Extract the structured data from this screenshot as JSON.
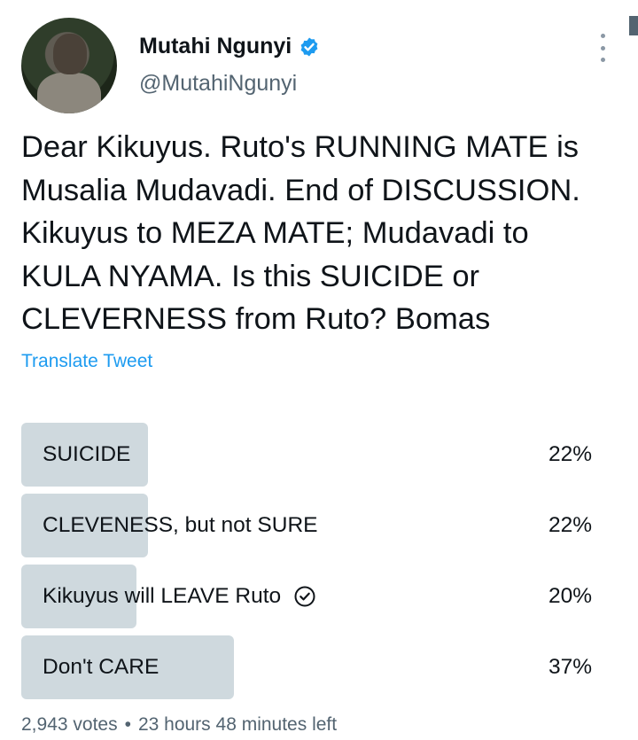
{
  "author": {
    "display_name": "Mutahi Ngunyi",
    "handle": "@MutahiNgunyi",
    "verified": true,
    "avatar_icon": "profile-photo",
    "verified_icon": "verified-badge-icon",
    "menu_icon": "more-options-icon"
  },
  "tweet": {
    "text": "Dear Kikuyus. Ruto's RUNNING MATE is\nMusalia Mudavadi. End of DISCUSSION.\nKikuyus to MEZA MATE; Mudavadi to\nKULA NYAMA. Is this SUICIDE or\nCLEVERNESS from Ruto? Bomas",
    "translate_label": "Translate Tweet"
  },
  "poll": {
    "options": [
      {
        "label": "SUICIDE",
        "percent_label": "22%",
        "percent": 22,
        "voted": false
      },
      {
        "label": "CLEVENESS, but not SURE",
        "percent_label": "22%",
        "percent": 22,
        "voted": false
      },
      {
        "label": "Kikuyus will LEAVE Ruto",
        "percent_label": "20%",
        "percent": 20,
        "voted": true
      },
      {
        "label": "Don't CARE",
        "percent_label": "37%",
        "percent": 37,
        "voted": false
      }
    ],
    "votes": "2,943 votes",
    "separator": "•",
    "time_left": "23 hours 48 minutes left"
  },
  "colors": {
    "text": "#0f1419",
    "secondary": "#536471",
    "link": "#1d9bf0",
    "bar": "#cfd9de",
    "verified": "#1d9bf0"
  }
}
